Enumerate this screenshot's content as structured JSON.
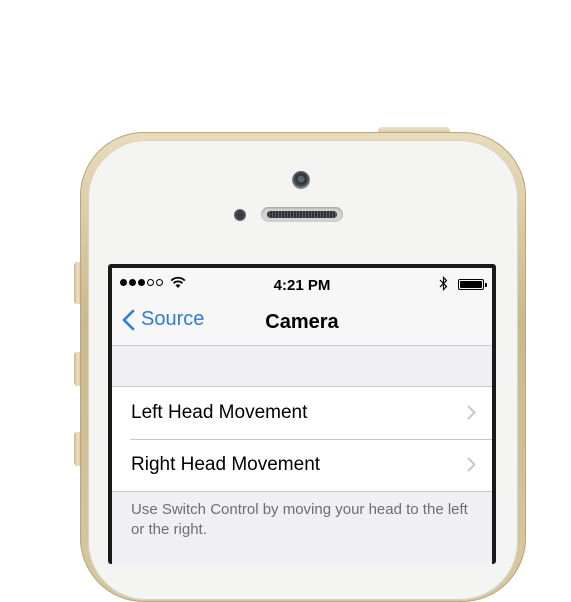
{
  "status_bar": {
    "time": "4:21 PM",
    "signal_bars_filled": 3,
    "signal_bars_total": 5,
    "icons": [
      "wifi-icon",
      "bluetooth-icon",
      "battery-icon"
    ]
  },
  "nav": {
    "back_label": "Source",
    "title": "Camera"
  },
  "rows": [
    {
      "label": "Left Head Movement"
    },
    {
      "label": "Right Head Movement"
    }
  ],
  "footer_text": "Use Switch Control by moving your head to the left or the right.",
  "colors": {
    "accent": "#2f7bd6",
    "background": "#efeff4",
    "bar": "#f7f7f7",
    "separator": "#c8c7cc",
    "footer_text": "#6d6d72",
    "chevron": "#c7c7cc"
  }
}
